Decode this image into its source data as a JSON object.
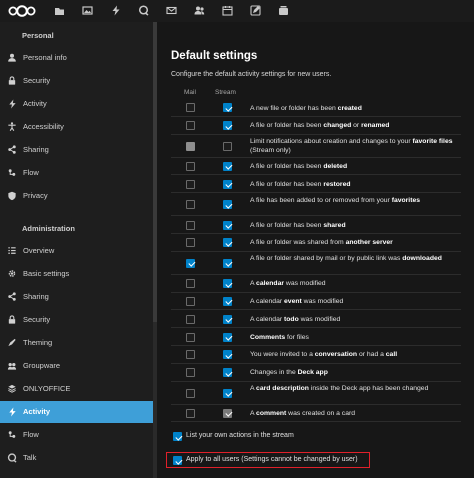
{
  "topbar": {
    "apps": [
      "files-icon",
      "photos-icon",
      "activity-icon",
      "talk-icon",
      "mail-icon",
      "contacts-icon",
      "calendar-icon",
      "notes-icon",
      "deck-icon"
    ]
  },
  "sidebar": {
    "personal_heading": "Personal",
    "personal": [
      {
        "label": "Personal info",
        "icon": "person-icon"
      },
      {
        "label": "Security",
        "icon": "lock-icon"
      },
      {
        "label": "Activity",
        "icon": "activity-icon"
      },
      {
        "label": "Accessibility",
        "icon": "accessibility-icon"
      },
      {
        "label": "Sharing",
        "icon": "share-icon"
      },
      {
        "label": "Flow",
        "icon": "flow-icon"
      },
      {
        "label": "Privacy",
        "icon": "privacy-icon"
      }
    ],
    "admin_heading": "Administration",
    "admin": [
      {
        "label": "Overview",
        "icon": "overview-icon"
      },
      {
        "label": "Basic settings",
        "icon": "gear-icon"
      },
      {
        "label": "Sharing",
        "icon": "share-icon"
      },
      {
        "label": "Security",
        "icon": "lock-icon"
      },
      {
        "label": "Theming",
        "icon": "theming-icon"
      },
      {
        "label": "Groupware",
        "icon": "groupware-icon"
      },
      {
        "label": "ONLYOFFICE",
        "icon": "onlyoffice-icon"
      },
      {
        "label": "Activity",
        "icon": "activity-icon",
        "active": true
      },
      {
        "label": "Flow",
        "icon": "flow-icon"
      },
      {
        "label": "Talk",
        "icon": "talk-icon"
      }
    ]
  },
  "main": {
    "title": "Default settings",
    "subtitle": "Configure the default activity settings for new users.",
    "col_mail": "Mail",
    "col_stream": "Stream",
    "rows": [
      {
        "parts": [
          [
            "A new file or folder has been ",
            0
          ],
          [
            "created",
            1
          ]
        ],
        "mail": false,
        "stream": true
      },
      {
        "parts": [
          [
            "A file or folder has been ",
            0
          ],
          [
            "changed",
            1
          ],
          [
            " or ",
            0
          ],
          [
            "renamed",
            1
          ]
        ],
        "mail": false,
        "stream": true
      },
      {
        "parts": [
          [
            "Limit notifications about creation and changes to your ",
            0
          ],
          [
            "favorite files",
            1
          ],
          [
            " (Stream only)",
            0
          ]
        ],
        "mail": false,
        "stream": false,
        "mail_disabled": true
      },
      {
        "parts": [
          [
            "A file or folder has been ",
            0
          ],
          [
            "deleted",
            1
          ]
        ],
        "mail": false,
        "stream": true
      },
      {
        "parts": [
          [
            "A file or folder has been ",
            0
          ],
          [
            "restored",
            1
          ]
        ],
        "mail": false,
        "stream": true
      },
      {
        "parts": [
          [
            "A file has been added to or removed from your ",
            0
          ],
          [
            "favorites",
            1
          ]
        ],
        "mail": false,
        "stream": true
      },
      {
        "parts": [
          [
            "A file or folder has been ",
            0
          ],
          [
            "shared",
            1
          ]
        ],
        "mail": false,
        "stream": true
      },
      {
        "parts": [
          [
            "A file or folder was shared from ",
            0
          ],
          [
            "another server",
            1
          ]
        ],
        "mail": false,
        "stream": true
      },
      {
        "parts": [
          [
            "A file or folder shared by mail or by public link was ",
            0
          ],
          [
            "downloaded",
            1
          ]
        ],
        "mail": true,
        "stream": true
      },
      {
        "parts": [
          [
            "A ",
            0
          ],
          [
            "calendar",
            1
          ],
          [
            " was modified",
            0
          ]
        ],
        "mail": false,
        "stream": true
      },
      {
        "parts": [
          [
            "A calendar ",
            0
          ],
          [
            "event",
            1
          ],
          [
            " was modified",
            0
          ]
        ],
        "mail": false,
        "stream": true
      },
      {
        "parts": [
          [
            "A calendar ",
            0
          ],
          [
            "todo",
            1
          ],
          [
            " was modified",
            0
          ]
        ],
        "mail": false,
        "stream": true
      },
      {
        "parts": [
          [
            "Comments",
            1
          ],
          [
            " for files",
            0
          ]
        ],
        "mail": false,
        "stream": true
      },
      {
        "parts": [
          [
            "You were invited to a ",
            0
          ],
          [
            "conversation",
            1
          ],
          [
            " or had a ",
            0
          ],
          [
            "call",
            1
          ]
        ],
        "mail": false,
        "stream": true
      },
      {
        "parts": [
          [
            "Changes in the ",
            0
          ],
          [
            "Deck app",
            1
          ]
        ],
        "mail": false,
        "stream": true
      },
      {
        "parts": [
          [
            "A ",
            0
          ],
          [
            "card description",
            1
          ],
          [
            " inside the Deck app has been changed",
            0
          ]
        ],
        "mail": false,
        "stream": true
      },
      {
        "parts": [
          [
            "A ",
            0
          ],
          [
            "comment",
            1
          ],
          [
            " was created on a card",
            0
          ]
        ],
        "mail": false,
        "stream": true,
        "stream_dim": true
      }
    ],
    "own_actions_label": "List your own actions in the stream",
    "own_actions_checked": true,
    "apply_all_label": "Apply to all users (Settings cannot be changed by user)",
    "apply_all_checked": true
  },
  "colors": {
    "accent": "#0082c9",
    "active_nav": "#3e9fd8",
    "highlight_border": "#e0202a"
  }
}
